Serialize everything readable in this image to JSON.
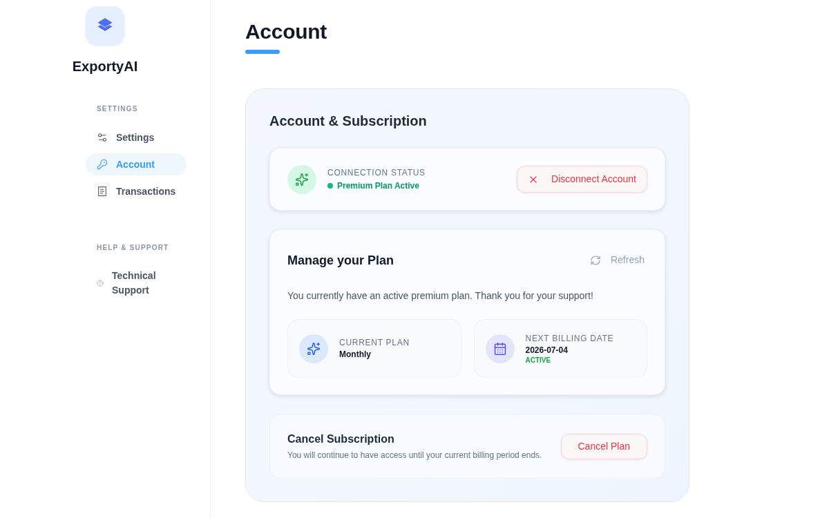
{
  "sidebar": {
    "app_name": "ExportyAI",
    "sections": [
      {
        "heading": "SETTINGS",
        "items": [
          {
            "label": "Settings",
            "selected": false
          },
          {
            "label": "Account",
            "selected": true
          },
          {
            "label": "Transactions",
            "selected": false
          }
        ]
      },
      {
        "heading": "HELP & SUPPORT",
        "items": [
          {
            "label": "Technical Support",
            "selected": false
          }
        ]
      }
    ]
  },
  "page": {
    "title": "Account",
    "card_title": "Account & Subscription",
    "connection": {
      "label": "CONNECTION STATUS",
      "status": "Premium Plan Active",
      "connected": true,
      "button": "Disconnect Account"
    },
    "plan": {
      "title": "Manage your Plan",
      "refresh": "Refresh",
      "message": "You currently have an active premium plan. Thank you for your support!",
      "details": [
        {
          "label": "CURRENT PLAN",
          "value": "Monthly"
        },
        {
          "label": "NEXT BILLING DATE",
          "value": "2026-07-04",
          "status": "ACTIVE"
        }
      ]
    },
    "cancel": {
      "title": "Cancel Subscription",
      "description": "You will continue to have access until your current billing period ends.",
      "button": "Cancel Plan"
    }
  }
}
